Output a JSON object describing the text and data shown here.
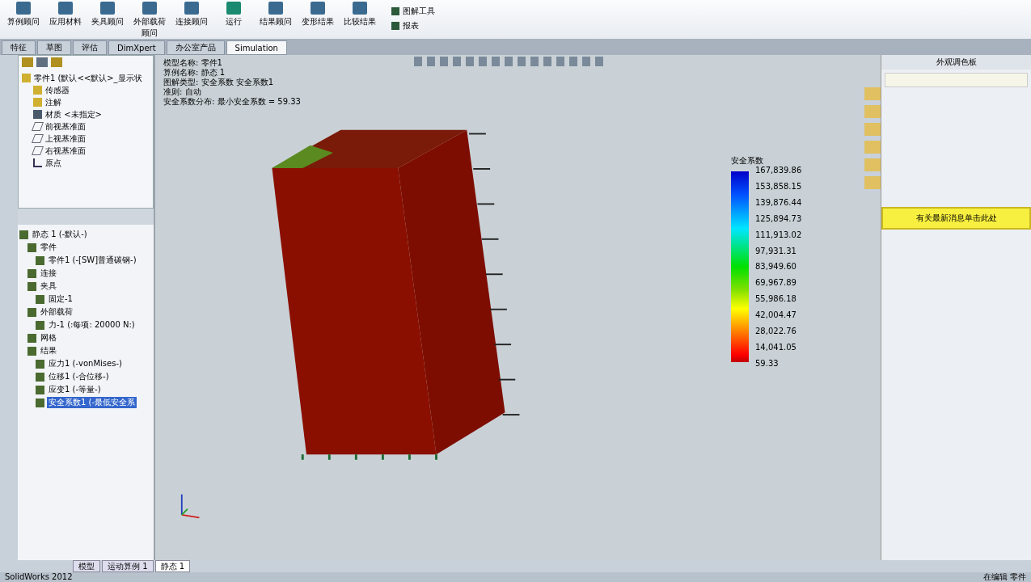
{
  "ribbon": {
    "buttons": [
      {
        "label": "算例顾问"
      },
      {
        "label": "应用材料"
      },
      {
        "label": "夹具顾问"
      },
      {
        "label": "外部载荷顾问"
      },
      {
        "label": "连接顾问"
      },
      {
        "label": "运行"
      },
      {
        "label": "结果顾问"
      },
      {
        "label": "变形结果"
      },
      {
        "label": "比较结果"
      }
    ],
    "side_buttons": [
      {
        "label": "图解工具"
      },
      {
        "label": "报表"
      }
    ]
  },
  "tabs": [
    {
      "label": "特征",
      "selected": false
    },
    {
      "label": "草图",
      "selected": false
    },
    {
      "label": "评估",
      "selected": false
    },
    {
      "label": "DimXpert",
      "selected": false
    },
    {
      "label": "办公室产品",
      "selected": false
    },
    {
      "label": "Simulation",
      "selected": true
    }
  ],
  "feature_tree": {
    "root": "零件1 (默认<<默认>_显示状",
    "items": [
      {
        "label": "传感器"
      },
      {
        "label": "注解"
      },
      {
        "label": "材质 <未指定>"
      },
      {
        "label": "前视基准面"
      },
      {
        "label": "上视基准面"
      },
      {
        "label": "右视基准面"
      },
      {
        "label": "原点"
      }
    ]
  },
  "study_tree": {
    "label": "静态 1 (-默认-)",
    "selected": false,
    "children": [
      {
        "label": "零件",
        "selected": false,
        "children": [
          {
            "label": "零件1 (-[SW]普通碳钢-)",
            "selected": false
          }
        ]
      },
      {
        "label": "连接",
        "selected": false
      },
      {
        "label": "夹具",
        "selected": false,
        "children": [
          {
            "label": "固定-1",
            "selected": false
          }
        ]
      },
      {
        "label": "外部载荷",
        "selected": false,
        "children": [
          {
            "label": "力-1 (:每项: 20000 N:)",
            "selected": false
          }
        ]
      },
      {
        "label": "网格",
        "selected": false
      },
      {
        "label": "结果",
        "selected": false,
        "children": [
          {
            "label": "应力1 (-vonMises-)",
            "selected": false
          },
          {
            "label": "位移1 (-合位移-)",
            "selected": false
          },
          {
            "label": "应变1 (-等量-)",
            "selected": false
          },
          {
            "label": "安全系数1 (-最低安全系",
            "selected": true
          }
        ]
      }
    ]
  },
  "viewport": {
    "info": [
      "模型名称: 零件1",
      "算例名称: 静态 1",
      "图解类型: 安全系数 安全系数1",
      "准则: 自动",
      "安全系数分布: 最小安全系数 = 59.33"
    ],
    "legend": {
      "title": "安全系数",
      "values": [
        "167,839.86",
        "153,858.15",
        "139,876.44",
        "125,894.73",
        "111,913.02",
        "97,931.31",
        "83,949.60",
        "69,967.89",
        "55,986.18",
        "42,004.47",
        "28,022.76",
        "14,041.05",
        "59.33"
      ]
    }
  },
  "task_pane": {
    "title": "外观调色板",
    "banner": "有关最新消息单击此处"
  },
  "bottom_tabs": [
    {
      "label": "模型",
      "selected": false
    },
    {
      "label": "运动算例 1",
      "selected": false
    },
    {
      "label": "静态 1",
      "selected": true
    }
  ],
  "status_bar": {
    "left": "SolidWorks 2012",
    "right": "在编辑 零件"
  }
}
